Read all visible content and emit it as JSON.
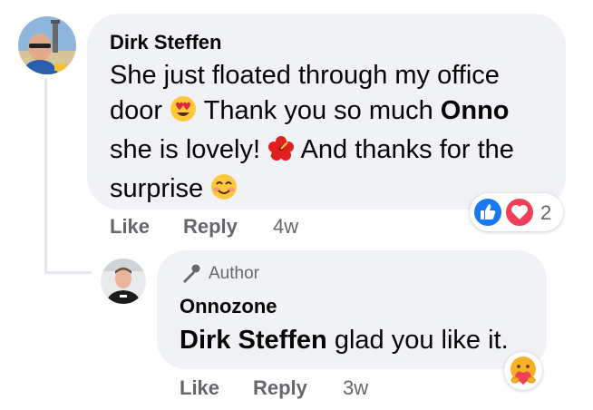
{
  "comments": [
    {
      "author": "Dirk Steffen",
      "text": {
        "line1": "She just floated through my office",
        "line2_a": "door",
        "line2_b": "Thank you so much",
        "line2_mention": "Onno",
        "line3_a": "she is lovely!",
        "line3_b": "And thanks for the",
        "line4": "surprise"
      },
      "emojis": [
        "heart-eyes-emoji",
        "hibiscus-emoji",
        "smiling-emoji"
      ],
      "actions": {
        "like": "Like",
        "reply": "Reply",
        "time": "4w"
      },
      "reactions": {
        "icons": [
          "like-reaction-icon",
          "love-reaction-icon"
        ],
        "count": "2"
      }
    },
    {
      "badge": "Author",
      "author": "Onnozone",
      "text": {
        "mention": "Dirk Steffen",
        "rest": "glad you like it."
      },
      "actions": {
        "like": "Like",
        "reply": "Reply",
        "time": "3w"
      },
      "reactions": {
        "icons": [
          "care-reaction-icon"
        ]
      }
    }
  ],
  "colors": {
    "bubble": "#f0f2f5",
    "meta_text": "#65676b",
    "like_blue": "#1877f2",
    "love_red": "#f33e58"
  }
}
